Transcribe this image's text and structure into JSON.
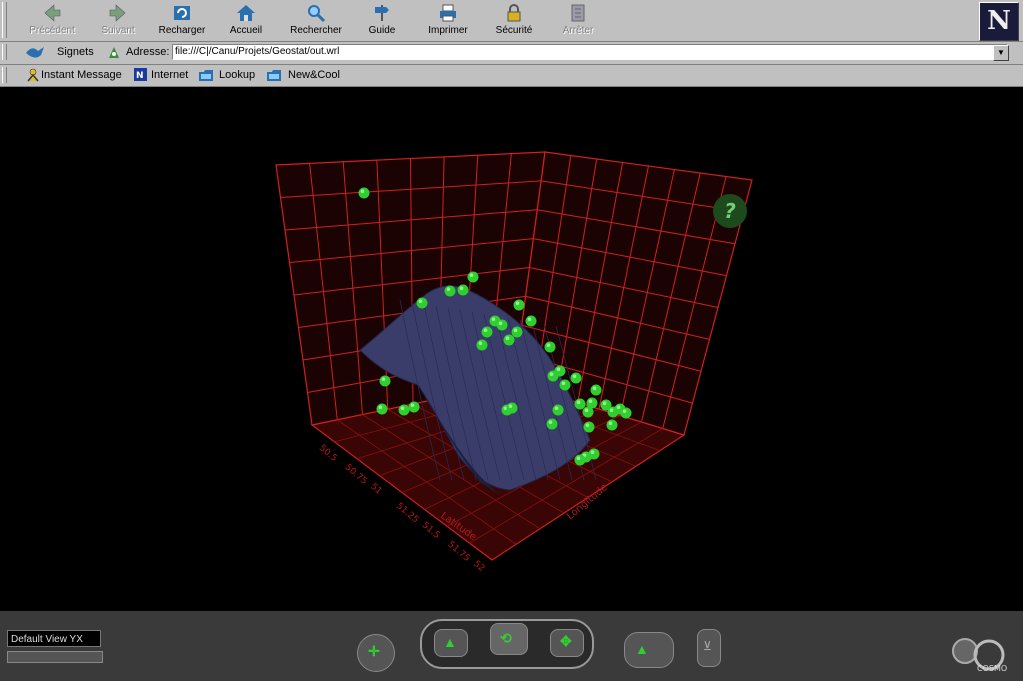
{
  "toolbar": {
    "buttons": [
      {
        "label": "Précédent",
        "icon": "back-arrow-icon",
        "enabled": false
      },
      {
        "label": "Suivant",
        "icon": "forward-arrow-icon",
        "enabled": false
      },
      {
        "label": "Recharger",
        "icon": "reload-icon",
        "enabled": true
      },
      {
        "label": "Accueil",
        "icon": "home-icon",
        "enabled": true
      },
      {
        "label": "Rechercher",
        "icon": "search-icon",
        "enabled": true
      },
      {
        "label": "Guide",
        "icon": "guide-icon",
        "enabled": true
      },
      {
        "label": "Imprimer",
        "icon": "print-icon",
        "enabled": true
      },
      {
        "label": "Sécurité",
        "icon": "lock-icon",
        "enabled": true
      },
      {
        "label": "Arrêter",
        "icon": "stop-icon",
        "enabled": false
      }
    ],
    "logo": "N"
  },
  "location": {
    "bookmarks_label": "Signets",
    "address_label": "Adresse:",
    "url": "file:///C|/Canu/Projets/Geostat/out.wrl"
  },
  "personal": {
    "items": [
      {
        "label": "Instant Message",
        "icon": "instant-message-icon"
      },
      {
        "label": "Internet",
        "icon": "internet-icon"
      },
      {
        "label": "Lookup",
        "icon": "folder-icon"
      },
      {
        "label": "New&Cool",
        "icon": "folder-icon"
      }
    ]
  },
  "scene": {
    "help_label": "?",
    "axis_left_label": "Latitude",
    "axis_right_label": "Longitude",
    "front_ticks": [
      "50.5",
      "50.75",
      "51",
      "51.25",
      "51.5",
      "51.75",
      "52"
    ],
    "colors": {
      "grid": "#d02020",
      "surface": "#3a3c6a",
      "points": "#2ed02e"
    }
  },
  "cosmo": {
    "view_label": "Default View YX",
    "brand": "COSMO"
  }
}
